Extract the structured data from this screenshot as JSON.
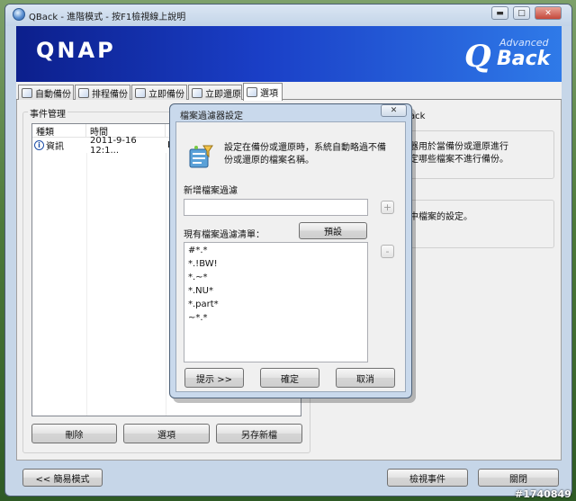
{
  "window": {
    "title": "QBack - 進階模式 - 按F1檢視線上說明",
    "caption_min": "▬",
    "caption_max": "□",
    "caption_close": "✕"
  },
  "banner": {
    "qnap": "QNAP",
    "advanced": "Advanced",
    "q": "Q",
    "back": "Back"
  },
  "tabs": [
    {
      "label": "自動備份"
    },
    {
      "label": "排程備份"
    },
    {
      "label": "立即備份"
    },
    {
      "label": "立即還原"
    },
    {
      "label": "選項"
    }
  ],
  "event_panel": {
    "title": "事件管理",
    "columns": [
      "種類",
      "時間",
      "和"
    ],
    "rows": [
      {
        "type": "資訊",
        "time": "2011-9-16 12:1...",
        "extra": "B"
      }
    ],
    "delete_button": "刪除",
    "options_button": "選項",
    "save_as_button": "另存新檔"
  },
  "right_panel": {
    "header_fragment": "ack",
    "text1_line1": "器用於當備份或還原進行",
    "text1_line2": "定哪些檔案不進行備份。",
    "text2": "中檔案的設定。"
  },
  "footer": {
    "simple_mode_button": "<< 簡易模式",
    "view_events_button": "檢視事件",
    "close_button": "關閉"
  },
  "dialog": {
    "title": "檔案過濾器設定",
    "close_glyph": "✕",
    "description_line1": "設定在備份或還原時，系統自動略過不備",
    "description_line2": "份或還原的檔案名稱。",
    "new_filter_label": "新增檔案過濾",
    "new_filter_value": "",
    "current_list_label": "現有檔案過濾清單：",
    "default_button": "預設",
    "add_button": "+",
    "remove_button": "-",
    "filters": [
      "#*.*",
      "*.!BW!",
      "*.~*",
      "*.NU*",
      "*.part*",
      "~*.*"
    ],
    "hint_button": "提示 >>",
    "ok_button": "確定",
    "cancel_button": "取消"
  },
  "watermark": "#1740849"
}
